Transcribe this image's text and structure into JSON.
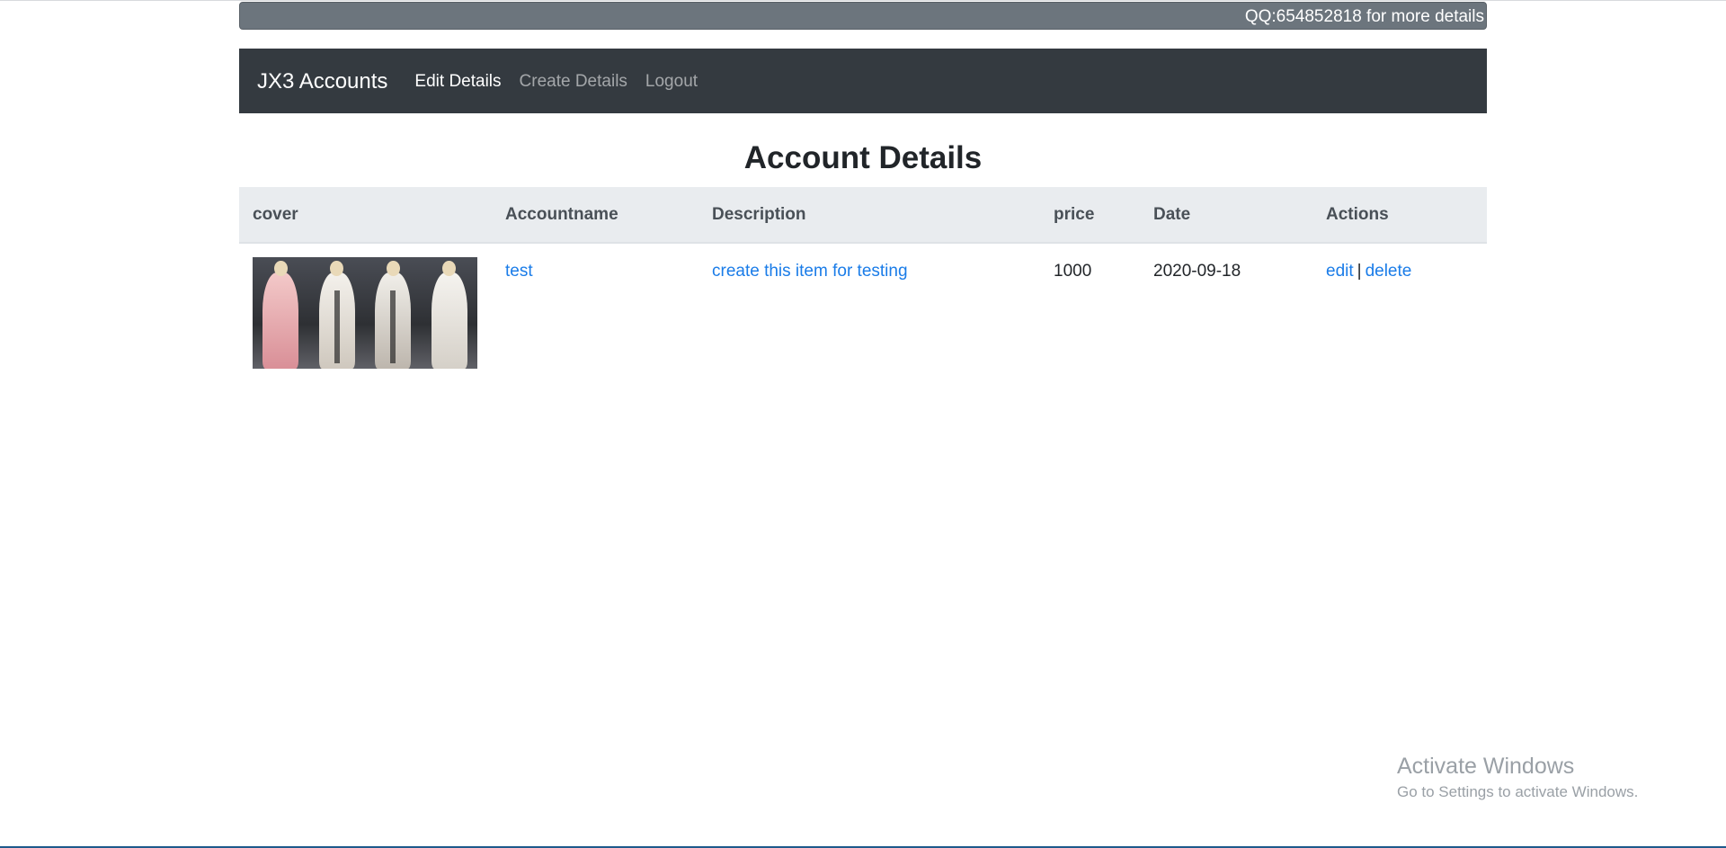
{
  "banner": {
    "text": "QQ:654852818 for more details"
  },
  "navbar": {
    "brand": "JX3 Accounts",
    "links": [
      {
        "label": "Edit Details",
        "active": true
      },
      {
        "label": "Create Details",
        "active": false
      },
      {
        "label": "Logout",
        "active": false
      }
    ]
  },
  "page": {
    "title": "Account Details"
  },
  "table": {
    "headers": [
      "cover",
      "Accountname",
      "Description",
      "price",
      "Date",
      "Actions"
    ],
    "rows": [
      {
        "cover_alt": "character costume cover image",
        "accountname": "test",
        "description": "create this item for testing",
        "price": "1000",
        "date": "2020-09-18",
        "actions": {
          "edit": "edit",
          "separator": "|",
          "delete": "delete"
        }
      }
    ]
  },
  "watermark": {
    "line1": "Activate Windows",
    "line2": "Go to Settings to activate Windows."
  },
  "colors": {
    "navbar_bg": "#343a40",
    "banner_bg": "#6c757d",
    "link": "#1a7ce8",
    "table_header_bg": "#e9ecef"
  }
}
